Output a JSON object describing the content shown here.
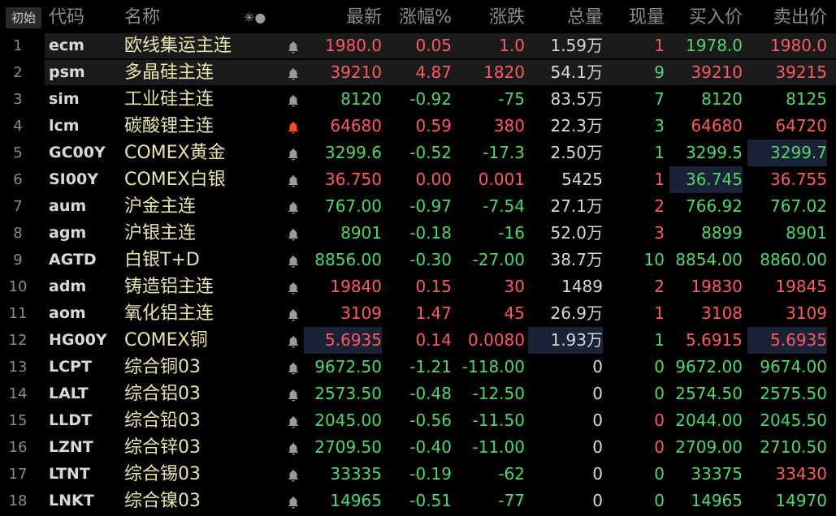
{
  "header": {
    "init_button": "初始",
    "code": "代码",
    "name": "名称",
    "settings_icon": "✳●",
    "last": "最新",
    "pct": "涨幅%",
    "chg": "涨跌",
    "vol": "总量",
    "cur": "现量",
    "bid": "买入价",
    "ask": "卖出价"
  },
  "colors": {
    "up": "#ff5a5a",
    "down": "#4cd964",
    "flat": "#d8d8d8",
    "name": "#e8e5a8",
    "alert_bell": "#ff4d1a",
    "bell": "#9a9a9a"
  },
  "rows": [
    {
      "num": "1",
      "code": "ecm",
      "name": "欧线集运主连",
      "bell": "bell-icon",
      "last": "1980.0",
      "pct": "0.05",
      "chg": "1.0",
      "vol": "1.59万",
      "cur": "1",
      "bid": "1978.0",
      "ask": "1980.0",
      "dir": "up",
      "cur_dir": "up",
      "bid_dir": "down",
      "ask_dir": "up",
      "hl": true
    },
    {
      "num": "2",
      "code": "psm",
      "name": "多晶硅主连",
      "bell": "bell-icon",
      "last": "39210",
      "pct": "4.87",
      "chg": "1820",
      "vol": "54.1万",
      "cur": "9",
      "bid": "39210",
      "ask": "39215",
      "dir": "up",
      "cur_dir": "down",
      "bid_dir": "up",
      "ask_dir": "up",
      "hl": true
    },
    {
      "num": "3",
      "code": "sim",
      "name": "工业硅主连",
      "bell": "bell-icon",
      "last": "8120",
      "pct": "-0.92",
      "chg": "-75",
      "vol": "83.5万",
      "cur": "7",
      "bid": "8120",
      "ask": "8125",
      "dir": "down",
      "cur_dir": "down",
      "bid_dir": "down",
      "ask_dir": "down"
    },
    {
      "num": "4",
      "code": "lcm",
      "name": "碳酸锂主连",
      "bell": "alert-bell-icon",
      "last": "64680",
      "pct": "0.59",
      "chg": "380",
      "vol": "22.3万",
      "cur": "3",
      "bid": "64680",
      "ask": "64720",
      "dir": "up",
      "cur_dir": "down",
      "bid_dir": "up",
      "ask_dir": "up"
    },
    {
      "num": "5",
      "code": "GC00Y",
      "name": "COMEX黄金",
      "bell": "bell-icon",
      "last": "3299.6",
      "pct": "-0.52",
      "chg": "-17.3",
      "vol": "2.50万",
      "cur": "1",
      "bid": "3299.5",
      "ask": "3299.7",
      "dir": "down",
      "cur_dir": "down",
      "bid_dir": "down",
      "ask_dir": "down",
      "ask_box": true
    },
    {
      "num": "6",
      "code": "SI00Y",
      "name": "COMEX白银",
      "bell": "bell-icon",
      "last": "36.750",
      "pct": "0.00",
      "chg": "0.001",
      "vol": "5425",
      "cur": "1",
      "bid": "36.745",
      "ask": "36.755",
      "dir": "up",
      "cur_dir": "up",
      "bid_dir": "down",
      "ask_dir": "up",
      "bid_box": true
    },
    {
      "num": "7",
      "code": "aum",
      "name": "沪金主连",
      "bell": "bell-icon",
      "last": "767.00",
      "pct": "-0.97",
      "chg": "-7.54",
      "vol": "27.1万",
      "cur": "2",
      "bid": "766.92",
      "ask": "767.02",
      "dir": "down",
      "cur_dir": "up",
      "bid_dir": "down",
      "ask_dir": "down"
    },
    {
      "num": "8",
      "code": "agm",
      "name": "沪银主连",
      "bell": "bell-icon",
      "last": "8901",
      "pct": "-0.18",
      "chg": "-16",
      "vol": "52.0万",
      "cur": "3",
      "bid": "8899",
      "ask": "8901",
      "dir": "down",
      "cur_dir": "up",
      "bid_dir": "down",
      "ask_dir": "down"
    },
    {
      "num": "9",
      "code": "AGTD",
      "name": "白银T+D",
      "bell": "bell-icon",
      "last": "8856.00",
      "pct": "-0.30",
      "chg": "-27.00",
      "vol": "38.7万",
      "cur": "10",
      "bid": "8854.00",
      "ask": "8860.00",
      "dir": "down",
      "cur_dir": "down",
      "bid_dir": "down",
      "ask_dir": "down"
    },
    {
      "num": "10",
      "code": "adm",
      "name": "铸造铝主连",
      "bell": "bell-icon",
      "last": "19840",
      "pct": "0.15",
      "chg": "30",
      "vol": "1489",
      "cur": "2",
      "bid": "19830",
      "ask": "19845",
      "dir": "up",
      "cur_dir": "up",
      "bid_dir": "up",
      "ask_dir": "up"
    },
    {
      "num": "11",
      "code": "aom",
      "name": "氧化铝主连",
      "bell": "bell-icon",
      "last": "3109",
      "pct": "1.47",
      "chg": "45",
      "vol": "26.9万",
      "cur": "1",
      "bid": "3108",
      "ask": "3109",
      "dir": "up",
      "cur_dir": "up",
      "bid_dir": "up",
      "ask_dir": "up"
    },
    {
      "num": "12",
      "code": "HG00Y",
      "name": "COMEX铜",
      "bell": "bell-icon",
      "last": "5.6935",
      "pct": "0.14",
      "chg": "0.0080",
      "vol": "1.93万",
      "cur": "1",
      "bid": "5.6915",
      "ask": "5.6935",
      "dir": "up",
      "cur_dir": "down",
      "bid_dir": "up",
      "ask_dir": "up",
      "last_box": true,
      "vol_box": true,
      "ask_box": true
    },
    {
      "num": "13",
      "code": "LCPT",
      "name": "综合铜03",
      "bell": "bell-icon",
      "last": "9672.50",
      "pct": "-1.21",
      "chg": "-118.00",
      "vol": "0",
      "cur": "0",
      "bid": "9672.00",
      "ask": "9674.00",
      "dir": "down",
      "cur_dir": "down",
      "bid_dir": "down",
      "ask_dir": "down"
    },
    {
      "num": "14",
      "code": "LALT",
      "name": "综合铝03",
      "bell": "bell-icon",
      "last": "2573.50",
      "pct": "-0.48",
      "chg": "-12.50",
      "vol": "0",
      "cur": "0",
      "bid": "2574.50",
      "ask": "2575.50",
      "dir": "down",
      "cur_dir": "down",
      "bid_dir": "down",
      "ask_dir": "down"
    },
    {
      "num": "15",
      "code": "LLDT",
      "name": "综合铅03",
      "bell": "bell-icon",
      "last": "2045.00",
      "pct": "-0.56",
      "chg": "-11.50",
      "vol": "0",
      "cur": "0",
      "bid": "2044.00",
      "ask": "2045.50",
      "dir": "down",
      "cur_dir": "up",
      "bid_dir": "down",
      "ask_dir": "down"
    },
    {
      "num": "16",
      "code": "LZNT",
      "name": "综合锌03",
      "bell": "bell-icon",
      "last": "2709.50",
      "pct": "-0.40",
      "chg": "-11.00",
      "vol": "0",
      "cur": "0",
      "bid": "2709.00",
      "ask": "2710.50",
      "dir": "down",
      "cur_dir": "up",
      "bid_dir": "down",
      "ask_dir": "down"
    },
    {
      "num": "17",
      "code": "LTNT",
      "name": "综合锡03",
      "bell": "bell-icon",
      "last": "33335",
      "pct": "-0.19",
      "chg": "-62",
      "vol": "0",
      "cur": "0",
      "bid": "33375",
      "ask": "33430",
      "dir": "down",
      "cur_dir": "down",
      "bid_dir": "down",
      "ask_dir": "up"
    },
    {
      "num": "18",
      "code": "LNKT",
      "name": "综合镍03",
      "bell": "bell-icon",
      "last": "14965",
      "pct": "-0.51",
      "chg": "-77",
      "vol": "0",
      "cur": "0",
      "bid": "14965",
      "ask": "14970",
      "dir": "down",
      "cur_dir": "down",
      "bid_dir": "down",
      "ask_dir": "down"
    }
  ]
}
